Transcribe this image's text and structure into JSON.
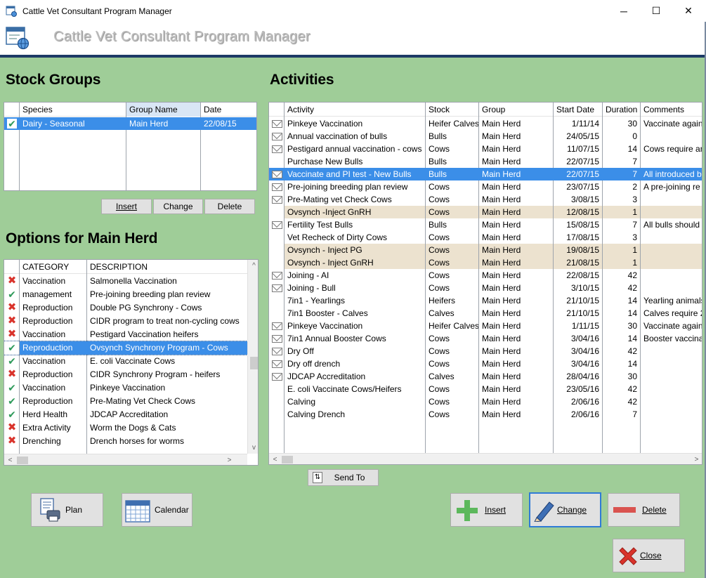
{
  "window": {
    "title": "Cattle Vet Consultant Program Manager",
    "subtitle": "Cattle Vet Consultant Program Manager",
    "minimize_glyph": "─",
    "maximize_glyph": "☐",
    "close_glyph": "✕"
  },
  "stock_groups": {
    "heading": "Stock Groups",
    "columns": [
      "Species",
      "Group Name",
      "Date"
    ],
    "rows": [
      {
        "status": "check",
        "species": "Dairy - Seasonal",
        "group_name": "Main Herd",
        "date": "22/08/15",
        "selected": true
      }
    ],
    "buttons": {
      "insert": "Insert",
      "change": "Change",
      "delete": "Delete"
    }
  },
  "options": {
    "heading": "Options for Main Herd",
    "columns": [
      "CATEGORY",
      "DESCRIPTION"
    ],
    "rows": [
      {
        "status": "cross",
        "category": "Vaccination",
        "description": "Salmonella Vaccination"
      },
      {
        "status": "check",
        "category": "management",
        "description": "Pre-joining breeding plan review"
      },
      {
        "status": "cross",
        "category": "Reproduction",
        "description": "Double PG Synchrony - Cows"
      },
      {
        "status": "cross",
        "category": "Reproduction",
        "description": "CIDR program to treat non-cycling cows"
      },
      {
        "status": "cross",
        "category": "Vaccination",
        "description": "Pestigard Vaccination heifers"
      },
      {
        "status": "check",
        "category": "Reproduction",
        "description": "Ovsynch Synchrony Program - Cows",
        "selected": true
      },
      {
        "status": "check",
        "category": "Vaccination",
        "description": "E. coli Vaccinate Cows"
      },
      {
        "status": "cross",
        "category": "Reproduction",
        "description": "CIDR Synchrony Program - heifers"
      },
      {
        "status": "check",
        "category": "Vaccination",
        "description": "Pinkeye Vaccination"
      },
      {
        "status": "check",
        "category": "Reproduction",
        "description": "Pre-Mating Vet Check Cows"
      },
      {
        "status": "check",
        "category": "Herd Health",
        "description": "JDCAP Accreditation"
      },
      {
        "status": "cross",
        "category": "Extra Activity",
        "description": "Worm the Dogs & Cats"
      },
      {
        "status": "cross",
        "category": "Drenching",
        "description": "Drench horses for worms"
      }
    ]
  },
  "activities": {
    "heading": "Activities",
    "columns": [
      "Activity",
      "Stock",
      "Group",
      "Start Date",
      "Duration",
      "Comments"
    ],
    "rows": [
      {
        "mail": true,
        "activity": "Pinkeye Vaccination",
        "stock": "Heifer Calves",
        "group": "Main Herd",
        "start": "1/11/14",
        "duration": "30",
        "comments": "Vaccinate again"
      },
      {
        "mail": true,
        "activity": "Annual vaccination of bulls",
        "stock": "Bulls",
        "group": "Main Herd",
        "start": "24/05/15",
        "duration": "0",
        "comments": ""
      },
      {
        "mail": true,
        "activity": "Pestigard annual vaccination - cows",
        "stock": "Cows",
        "group": "Main Herd",
        "start": "11/07/15",
        "duration": "14",
        "comments": "Cows require an"
      },
      {
        "mail": false,
        "activity": "Purchase New Bulls",
        "stock": "Bulls",
        "group": "Main Herd",
        "start": "22/07/15",
        "duration": "7",
        "comments": ""
      },
      {
        "mail": true,
        "activity": "Vaccinate and PI test  - New Bulls",
        "stock": "Bulls",
        "group": "Main Herd",
        "start": "22/07/15",
        "duration": "7",
        "comments": "All introduced b",
        "selected": true
      },
      {
        "mail": true,
        "activity": "Pre-joining breeding plan review",
        "stock": "Cows",
        "group": "Main Herd",
        "start": "23/07/15",
        "duration": "2",
        "comments": "A pre-joining re"
      },
      {
        "mail": true,
        "activity": "Pre-Mating vet Check Cows",
        "stock": "Cows",
        "group": "Main Herd",
        "start": "3/08/15",
        "duration": "3",
        "comments": ""
      },
      {
        "mail": false,
        "activity": "Ovsynch -Inject GnRH",
        "stock": "Cows",
        "group": "Main Herd",
        "start": "12/08/15",
        "duration": "1",
        "comments": "",
        "beige": true
      },
      {
        "mail": true,
        "activity": "Fertility Test  Bulls",
        "stock": "Bulls",
        "group": "Main Herd",
        "start": "15/08/15",
        "duration": "7",
        "comments": "All bulls should b"
      },
      {
        "mail": false,
        "activity": "Vet Recheck  of Dirty Cows",
        "stock": "Cows",
        "group": "Main Herd",
        "start": "17/08/15",
        "duration": "3",
        "comments": ""
      },
      {
        "mail": false,
        "activity": "Ovsynch - Inject PG",
        "stock": "Cows",
        "group": "Main Herd",
        "start": "19/08/15",
        "duration": "1",
        "comments": "",
        "beige": true
      },
      {
        "mail": false,
        "activity": "Ovsynch - Inject GnRH",
        "stock": "Cows",
        "group": "Main Herd",
        "start": "21/08/15",
        "duration": "1",
        "comments": "",
        "beige": true
      },
      {
        "mail": true,
        "activity": "Joining - AI",
        "stock": "Cows",
        "group": "Main Herd",
        "start": "22/08/15",
        "duration": "42",
        "comments": ""
      },
      {
        "mail": true,
        "activity": "Joining - Bull",
        "stock": "Cows",
        "group": "Main Herd",
        "start": "3/10/15",
        "duration": "42",
        "comments": ""
      },
      {
        "mail": false,
        "activity": "7in1 - Yearlings",
        "stock": "Heifers",
        "group": "Main Herd",
        "start": "21/10/15",
        "duration": "14",
        "comments": "Yearling animals"
      },
      {
        "mail": false,
        "activity": "7in1 Booster - Calves",
        "stock": "Calves",
        "group": "Main Herd",
        "start": "21/10/15",
        "duration": "14",
        "comments": "Calves require 2"
      },
      {
        "mail": true,
        "activity": "Pinkeye Vaccination",
        "stock": "Heifer Calves",
        "group": "Main Herd",
        "start": "1/11/15",
        "duration": "30",
        "comments": "Vaccinate again"
      },
      {
        "mail": true,
        "activity": "7in1 Annual Booster Cows",
        "stock": "Cows",
        "group": "Main Herd",
        "start": "3/04/16",
        "duration": "14",
        "comments": "Booster vaccina"
      },
      {
        "mail": true,
        "activity": "Dry Off",
        "stock": "Cows",
        "group": "Main Herd",
        "start": "3/04/16",
        "duration": "42",
        "comments": ""
      },
      {
        "mail": true,
        "activity": "Dry off drench",
        "stock": "Cows",
        "group": "Main Herd",
        "start": "3/04/16",
        "duration": "14",
        "comments": ""
      },
      {
        "mail": true,
        "activity": "JDCAP Accreditation",
        "stock": "Calves",
        "group": "Main Herd",
        "start": "28/04/16",
        "duration": "30",
        "comments": ""
      },
      {
        "mail": false,
        "activity": "E. coli Vaccinate Cows/Heifers",
        "stock": "Cows",
        "group": "Main Herd",
        "start": "23/05/16",
        "duration": "42",
        "comments": ""
      },
      {
        "mail": false,
        "activity": "Calving",
        "stock": "Cows",
        "group": "Main Herd",
        "start": "2/06/16",
        "duration": "42",
        "comments": ""
      },
      {
        "mail": false,
        "activity": "Calving Drench",
        "stock": "Cows",
        "group": "Main Herd",
        "start": "2/06/16",
        "duration": "7",
        "comments": ""
      }
    ]
  },
  "buttons": {
    "send_to": "Send To",
    "plan": "Plan",
    "calendar": "Calendar",
    "insert": "Insert",
    "change": "Change",
    "delete": "Delete",
    "close": "Close"
  },
  "icons": {
    "check": "✔",
    "cross": "✖",
    "scroll_left": "<",
    "scroll_right": ">",
    "scroll_up": "^",
    "scroll_down": "v"
  },
  "colors": {
    "background": "#9fcd98",
    "selection": "#3b8ee8",
    "beige_row": "#ece2cf",
    "check": "#2e9a5a",
    "cross": "#d9332b"
  }
}
